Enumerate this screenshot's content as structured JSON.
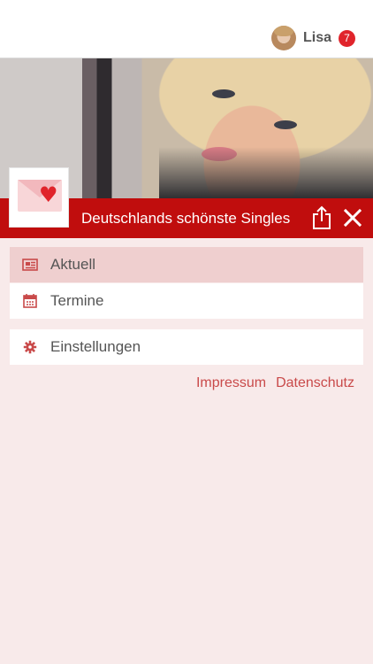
{
  "header": {
    "user_name": "Lisa",
    "notification_count": "7"
  },
  "banner": {
    "title": "Deutschlands schönste Singles"
  },
  "menu": {
    "items": [
      {
        "label": "Aktuell",
        "icon": "newspaper-icon",
        "active": true
      },
      {
        "label": "Termine",
        "icon": "calendar-icon",
        "active": false
      }
    ],
    "settings": {
      "label": "Einstellungen",
      "icon": "gear-icon"
    }
  },
  "footer_links": {
    "impressum": "Impressum",
    "datenschutz": "Datenschutz"
  },
  "colors": {
    "brand_red": "#c00d0d",
    "badge_red": "#e0242b",
    "page_bg": "#f8eaea",
    "active_item_bg": "#efcfcf",
    "link": "#c94a4a"
  }
}
